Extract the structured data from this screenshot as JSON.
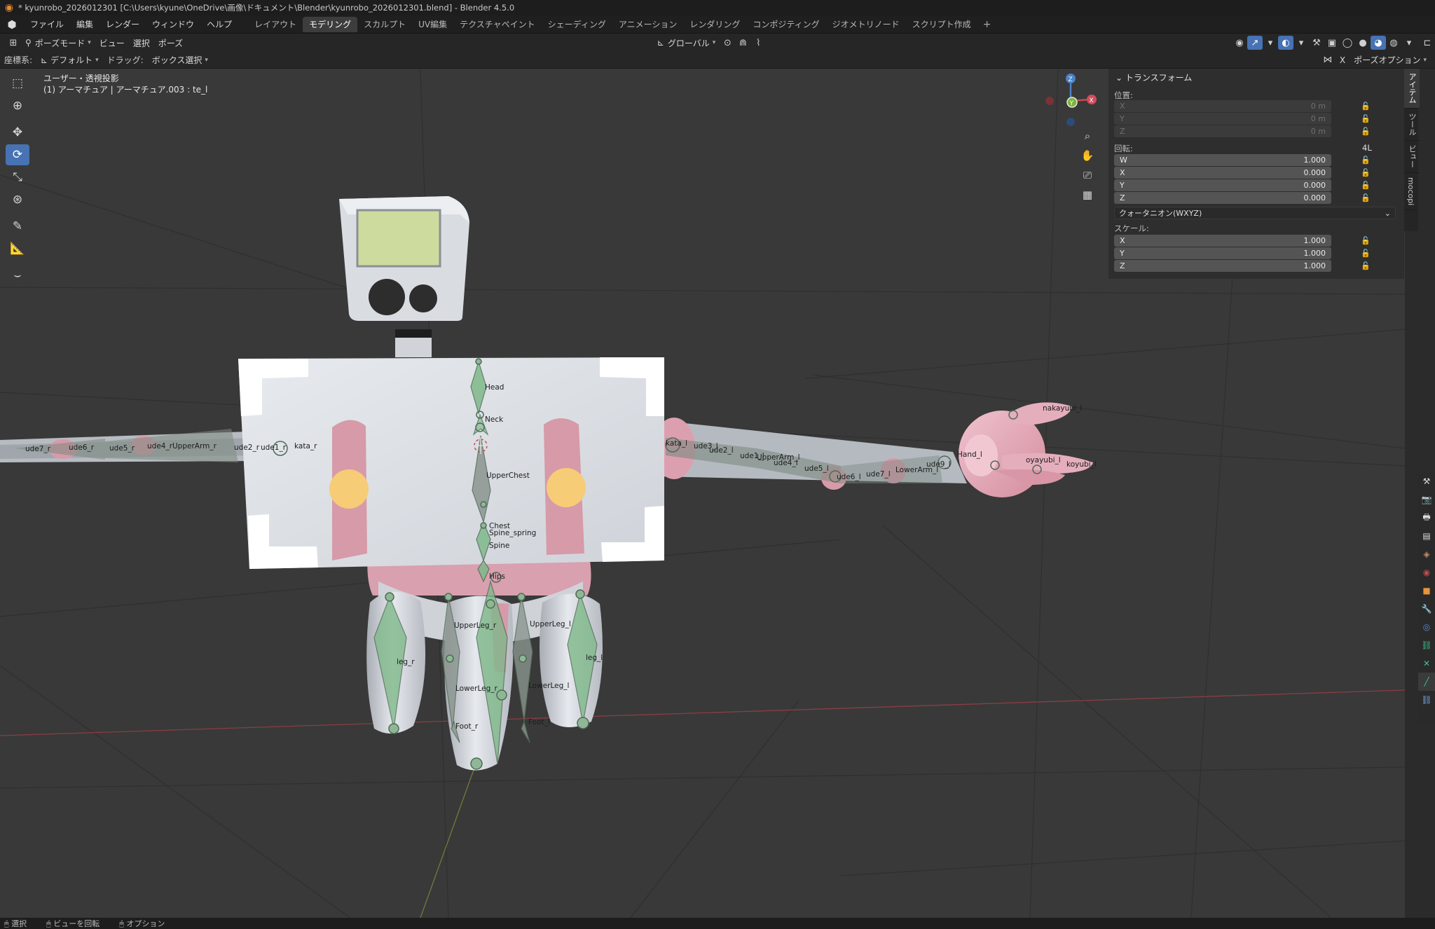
{
  "window": {
    "title": "* kyunrobo_2026012301 [C:\\Users\\kyune\\OneDrive\\画像\\ドキュメント\\Blender\\kyunrobo_2026012301.blend] - Blender 4.5.0"
  },
  "menu": [
    "ファイル",
    "編集",
    "レンダー",
    "ウィンドウ",
    "ヘルプ"
  ],
  "workspaces": [
    {
      "label": "レイアウト",
      "active": false
    },
    {
      "label": "モデリング",
      "active": true
    },
    {
      "label": "スカルプト",
      "active": false
    },
    {
      "label": "UV編集",
      "active": false
    },
    {
      "label": "テクスチャペイント",
      "active": false
    },
    {
      "label": "シェーディング",
      "active": false
    },
    {
      "label": "アニメーション",
      "active": false
    },
    {
      "label": "レンダリング",
      "active": false
    },
    {
      "label": "コンポジティング",
      "active": false
    },
    {
      "label": "ジオメトリノード",
      "active": false
    },
    {
      "label": "スクリプト作成",
      "active": false
    }
  ],
  "workspace_add": "+",
  "viewport_header": {
    "mode": "ポーズモード",
    "menus": [
      "ビュー",
      "選択",
      "ポーズ"
    ],
    "transform_orientation": "グローバル",
    "pose_options": "ポーズオプション",
    "snap_shortcut": "X"
  },
  "tool_settings": {
    "coord_label": "座標系:",
    "coord_value": "デフォルト",
    "drag_label": "ドラッグ:",
    "drag_value": "ボックス選択"
  },
  "viewport_overlay": {
    "line1": "ユーザー・透視投影",
    "line2": "(1) アーマチュア | アーマチュア.003 : te_l"
  },
  "gizmo": {
    "x": "X",
    "y": "Y",
    "z": "Z"
  },
  "transform_panel": {
    "title": "トランスフォーム",
    "location_label": "位置:",
    "location": [
      {
        "axis": "X",
        "value": "0 m"
      },
      {
        "axis": "Y",
        "value": "0 m"
      },
      {
        "axis": "Z",
        "value": "0 m"
      }
    ],
    "rotation_label": "回転:",
    "rotation_mode_badge": "4L",
    "rotation": [
      {
        "axis": "W",
        "value": "1.000"
      },
      {
        "axis": "X",
        "value": "0.000"
      },
      {
        "axis": "Y",
        "value": "0.000"
      },
      {
        "axis": "Z",
        "value": "0.000"
      }
    ],
    "rotation_mode": "クォータニオン(WXYZ)",
    "scale_label": "スケール:",
    "scale": [
      {
        "axis": "X",
        "value": "1.000"
      },
      {
        "axis": "Y",
        "value": "1.000"
      },
      {
        "axis": "Z",
        "value": "1.000"
      }
    ]
  },
  "sidebar_tabs": [
    "アイテム",
    "ツール",
    "ビュー",
    "mocopi"
  ],
  "bone_labels": {
    "head": "Head",
    "neck": "Neck",
    "upper_chest": "UpperChest",
    "chest": "Chest",
    "spine_spring": "Spine_spring",
    "spine": "Spine",
    "hips": "Hips",
    "upper_leg_r": "UpperLeg_r",
    "upper_leg_l": "UpperLeg_l",
    "leg_r": "leg_r",
    "leg_l": "leg_l",
    "lower_leg_r": "LowerLeg_r",
    "lower_leg_l": "LowerLeg_l",
    "foot_r": "Foot_r",
    "foot_l": "Foot_l",
    "kata_l": "kata_l",
    "ude3_l": "ude3_l",
    "ude2_l": "ude2_l",
    "ude1_l": "ude1_l",
    "upperarm_l": "UpperArm_l",
    "ude4_l": "ude4_l",
    "ude5_l": "ude5_l",
    "ude6_l": "ude6_l",
    "ude7_l": "ude7_l",
    "lowerarm_l": "LowerArm_l",
    "ude9_l": "ude9_l",
    "hand_l": "Hand_l",
    "nakayubi_l": "nakayubi_l",
    "oyayubi_l": "oyayubi_l",
    "koyubi_l": "koyubi_l",
    "ude7_r": "ude7_r",
    "ude6_r": "ude6_r",
    "ude5_r": "ude5_r",
    "ude4_r": "ude4_r",
    "upperarm_r": "UpperArm_r",
    "ude2_r": "ude2_r",
    "ude1_r": "ude1_r",
    "kata_r": "kata_r"
  },
  "statusbar": [
    "選択",
    "ビューを回転",
    "オプション"
  ],
  "colors": {
    "accent": "#4772b3",
    "bone_green": "#7fb98a",
    "body_pink": "#d79aa9",
    "body_white": "#dde1e6",
    "screen_green": "#cfdca0",
    "circle_yellow": "#f6cc77"
  }
}
